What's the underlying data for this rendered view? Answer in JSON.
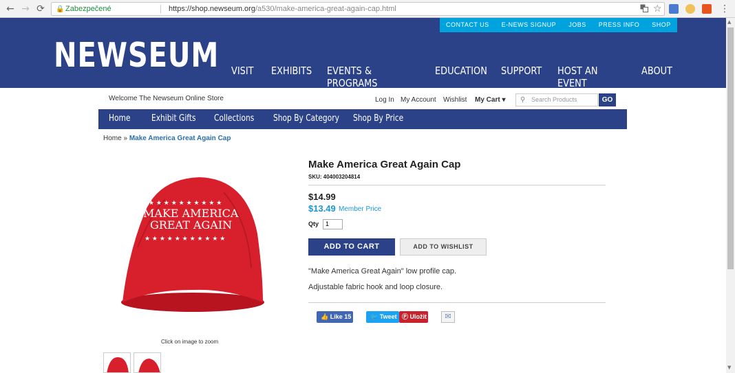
{
  "browser": {
    "back_icon": "←",
    "forward_icon": "→",
    "reload_icon": "⟳",
    "secure_label": "Zabezpečené",
    "url_host": "https://shop.newseum.org",
    "url_path": "/a530/make-america-great-again-cap.html",
    "translate_icon": "translate-icon",
    "bookmark_icon": "☆",
    "menu_icon": "⋮"
  },
  "header": {
    "toplinks": [
      "CONTACT US",
      "E-NEWS SIGNUP",
      "JOBS",
      "PRESS INFO",
      "SHOP"
    ],
    "logo": "NEWSEUM",
    "nav": [
      "VISIT",
      "EXHIBITS",
      "EVENTS & PROGRAMS",
      "EDUCATION",
      "SUPPORT",
      "HOST AN EVENT",
      "ABOUT"
    ]
  },
  "store": {
    "welcome": "Welcome The Newseum Online Store",
    "login": "Log In",
    "account": "My Account",
    "wishlist": "Wishlist",
    "cart": "My Cart ▾",
    "search_placeholder": "Search Products",
    "go": "GO",
    "nav": [
      "Home",
      "Exhibit Gifts",
      "Collections",
      "Shop By Category",
      "Shop By Price"
    ]
  },
  "breadcrumb": {
    "home": "Home",
    "sep": " » ",
    "current": "Make America Great Again Cap"
  },
  "product": {
    "title": "Make America Great Again Cap",
    "sku": "SKU: 404003204814",
    "price": "$14.99",
    "member_price": "$13.49",
    "member_label": "Member Price",
    "qty_label": "Qty",
    "qty_value": "1",
    "add_to_cart": "ADD TO CART",
    "add_to_wishlist": "ADD TO WISHLIST",
    "desc1": "\"Make America Great Again\" low profile cap.",
    "desc2": "Adjustable fabric hook and loop closure.",
    "zoom_hint": "Click on image to zoom",
    "cap_text_line1": "MAKE AMERICA",
    "cap_text_line2": "GREAT AGAIN"
  },
  "social": {
    "like": "Like",
    "like_count": "15",
    "tweet": "Tweet",
    "pin": "Uložit"
  },
  "colors": {
    "navy": "#2b4289",
    "cyan": "#00a3dd",
    "cap_red": "#d8202c",
    "member_blue": "#1a97d8"
  }
}
